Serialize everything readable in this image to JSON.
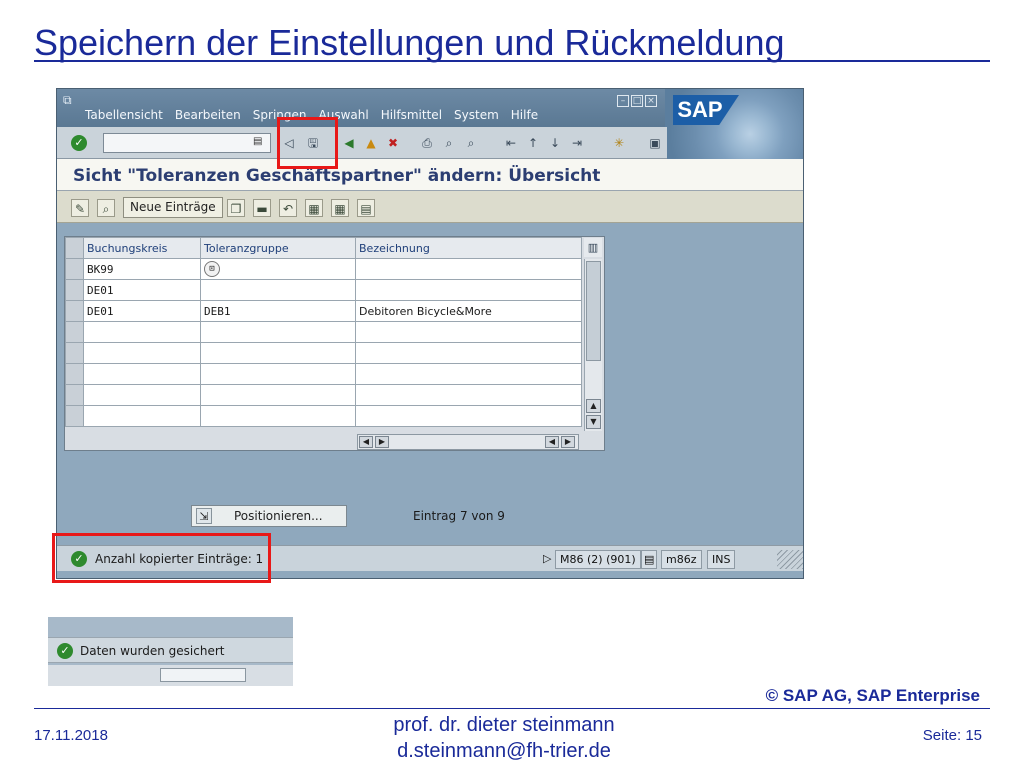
{
  "slide": {
    "title": "Speichern der Einstellungen und Rückmeldung",
    "copyright": "© SAP AG, SAP Enterprise",
    "footer": {
      "date": "17.11.2018",
      "author": "prof. dr. dieter steinmann",
      "email": "d.steinmann@fh-trier.de",
      "page_label": "Seite:",
      "page_number": "15"
    }
  },
  "sap": {
    "logo": "SAP",
    "menu": [
      "Tabellensicht",
      "Bearbeiten",
      "Springen",
      "Auswahl",
      "Hilfsmittel",
      "System",
      "Hilfe"
    ],
    "window_title": "Sicht \"Toleranzen Geschäftspartner\" ändern: Übersicht",
    "app_toolbar": {
      "new_entries_label": "Neue Einträge"
    },
    "table": {
      "columns": [
        "Buchungskreis",
        "Toleranzgruppe",
        "Bezeichnung"
      ],
      "rows": [
        [
          "BK99",
          "",
          ""
        ],
        [
          "DE01",
          "",
          ""
        ],
        [
          "DE01",
          "DEB1",
          "Debitoren Bicycle&More"
        ],
        [
          "",
          "",
          ""
        ],
        [
          "",
          "",
          ""
        ],
        [
          "",
          "",
          ""
        ],
        [
          "",
          "",
          ""
        ],
        [
          "",
          "",
          ""
        ]
      ]
    },
    "position_button_label": "Positionieren...",
    "entry_count": "Eintrag 7 von 9",
    "status": {
      "message": "Anzahl kopierter Einträge: 1",
      "system": "M86 (2) (901)",
      "server": "m86z",
      "mode": "INS"
    },
    "colors": {
      "frame_highlight": "#e81818",
      "status_ok": "#2e8a2e"
    }
  },
  "snippet": {
    "message": "Daten wurden gesichert"
  }
}
